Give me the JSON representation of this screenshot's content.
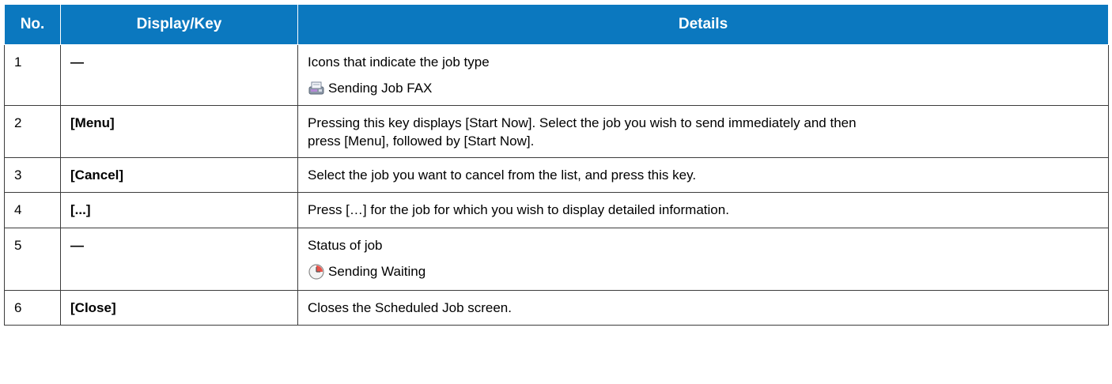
{
  "headers": {
    "no": "No.",
    "display_key": "Display/Key",
    "details": "Details"
  },
  "rows": [
    {
      "no": "1",
      "key": "—",
      "details": "Icons that indicate the job type",
      "sub_label": "Sending Job FAX",
      "sub_icon": "fax-icon"
    },
    {
      "no": "2",
      "key": "[Menu]",
      "details_line1": "Pressing this key displays [Start Now]. Select the job you wish to send immediately and then",
      "details_line2": "press [Menu], followed by [Start Now]."
    },
    {
      "no": "3",
      "key": "[Cancel]",
      "details": "Select the job you want to cancel from the list, and press this key."
    },
    {
      "no": "4",
      "key": "[...]",
      "details": "Press […] for the job for which you wish to display detailed information."
    },
    {
      "no": "5",
      "key": "—",
      "details": "Status of job",
      "sub_label": "Sending Waiting",
      "sub_icon": "clock-icon"
    },
    {
      "no": "6",
      "key": "[Close]",
      "details": "Closes the Scheduled Job screen."
    }
  ],
  "colors": {
    "header_bg": "#0b78bf",
    "header_text": "#ffffff",
    "border": "#3c3c3c"
  }
}
